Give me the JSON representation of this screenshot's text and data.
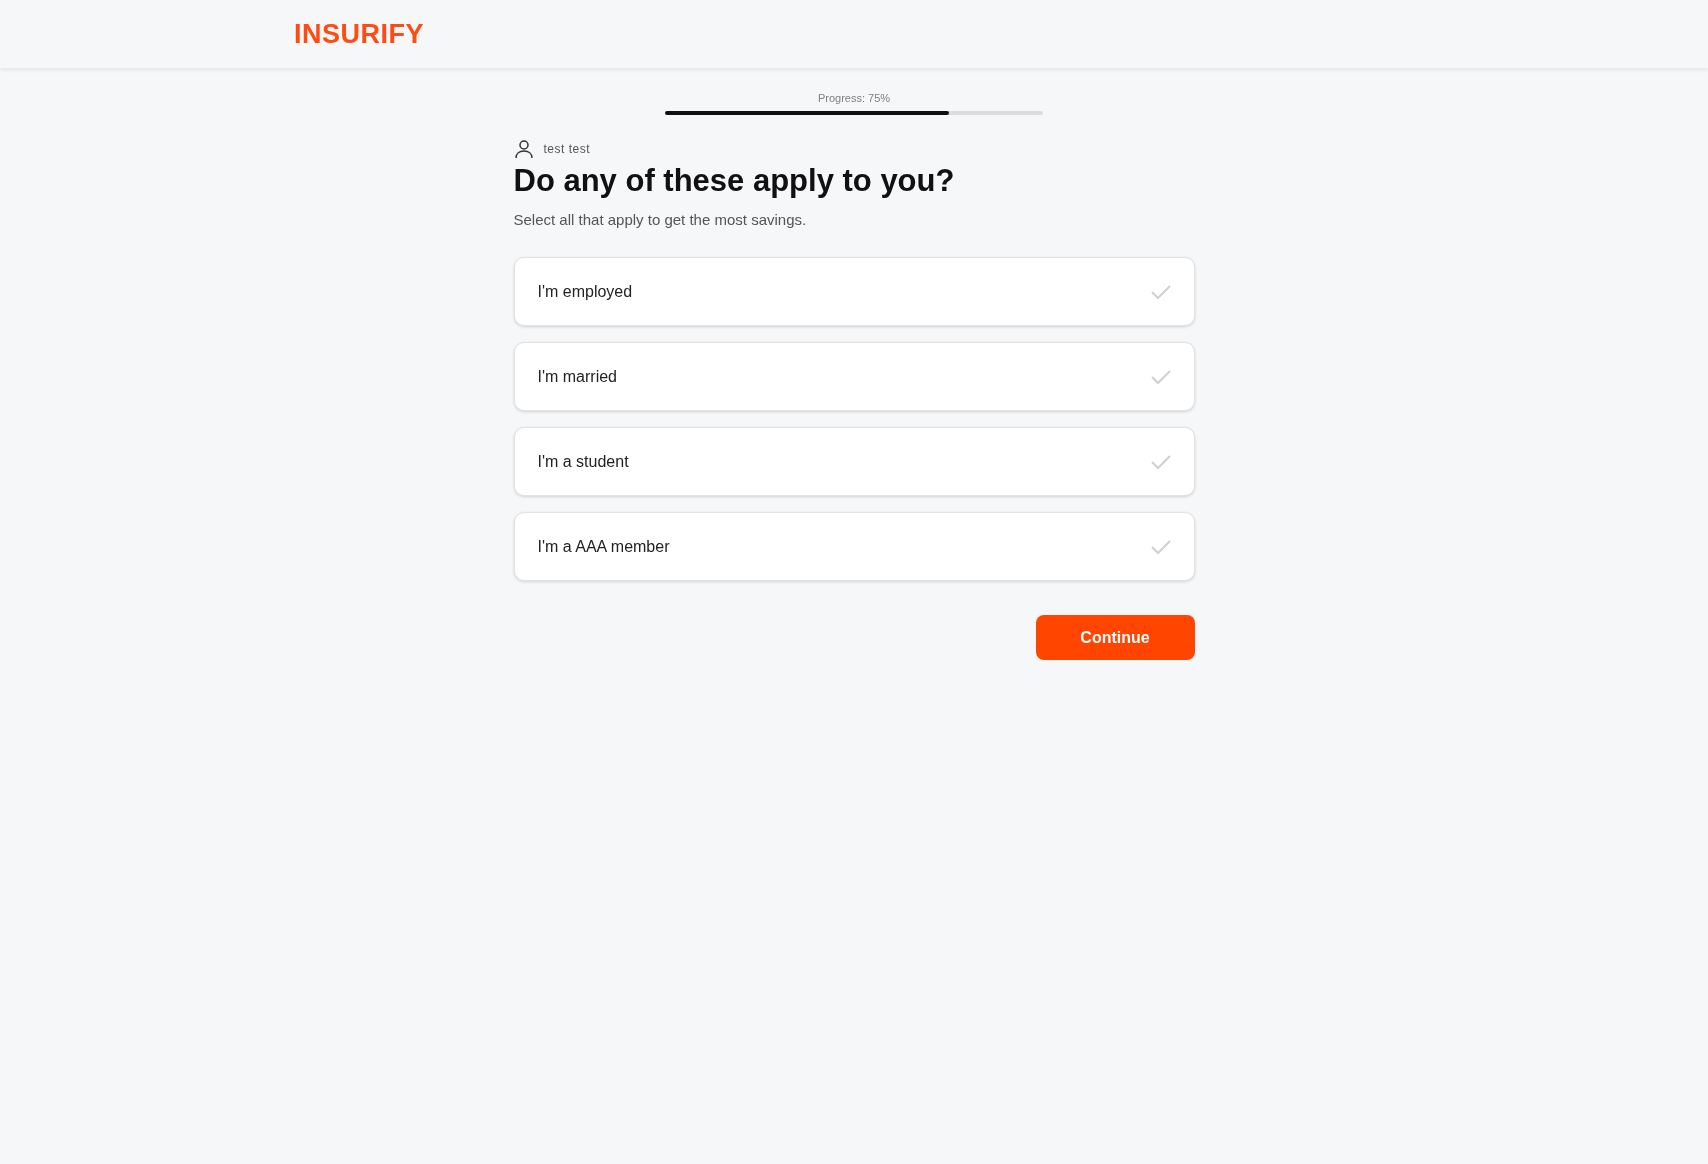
{
  "header": {
    "logo": "INSURIFY"
  },
  "progress": {
    "label": "Progress: 75%",
    "level": 0.75
  },
  "user": {
    "name": "test test"
  },
  "question": {
    "title": "Do any of these apply to you?",
    "subtitle": "Select all that apply to get the most savings."
  },
  "options": [
    {
      "label": "I'm employed",
      "checked": false
    },
    {
      "label": "I'm married",
      "checked": false
    },
    {
      "label": "I'm a student",
      "checked": false
    },
    {
      "label": "I'm a AAA member",
      "checked": false
    }
  ],
  "continue_button": "Continue"
}
